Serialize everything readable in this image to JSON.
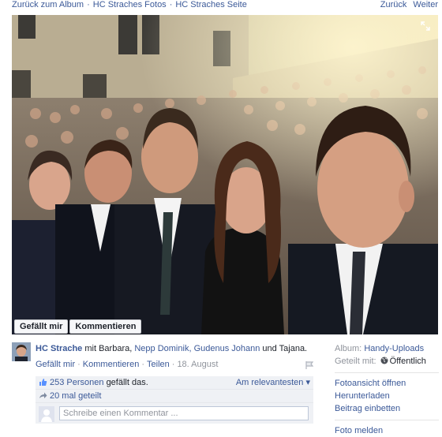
{
  "nav": {
    "back_to_album": "Zurück zum Album",
    "photos": "HC Straches Fotos",
    "page": "HC Straches Seite",
    "separator": "·",
    "back": "Zurück",
    "next": "Weiter"
  },
  "photo": {
    "actions": {
      "like": "Gefällt mir",
      "comment": "Kommentieren"
    },
    "icons": {
      "expand": "expand-icon"
    }
  },
  "post": {
    "author": "HC Strache",
    "with_word": "mit",
    "tag1": "Barbara,",
    "tag2": "Nepp Dominik,",
    "tag3": "Gudenus Johann",
    "and_word": "und",
    "tag4": "Tajana.",
    "like": "Gefällt mir",
    "comment": "Kommentieren",
    "share": "Teilen",
    "date": "18. August",
    "separator": "·"
  },
  "ufi": {
    "likes_count": "253 Personen",
    "likes_suffix": "gefällt das.",
    "sort_label": "Am relevantesten ▾",
    "shares": "20 mal geteilt",
    "comment_placeholder": "Schreibe einen Kommentar ..."
  },
  "sidebar": {
    "album_label": "Album:",
    "album_value": "Handy-Uploads",
    "shared_label": "Geteilt mit:",
    "shared_value": "Öffentlich",
    "actions": [
      "Fotoansicht öffnen",
      "Herunterladen",
      "Beitrag einbetten"
    ],
    "report": "Foto melden"
  },
  "colors": {
    "link": "#3b5998",
    "muted": "#90949c",
    "ufi_bg": "#eff1f5"
  }
}
